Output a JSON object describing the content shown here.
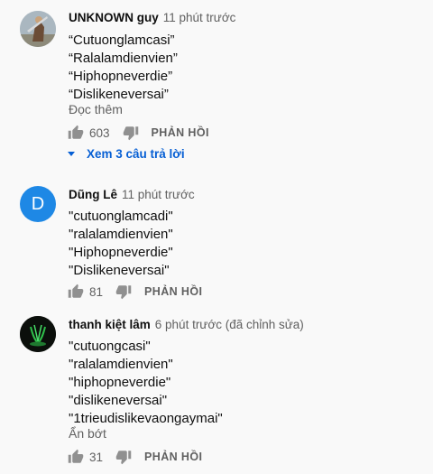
{
  "colors": {
    "link": "#065fd4",
    "muted": "#606060",
    "avatar_d": "#1e88e5"
  },
  "comments": [
    {
      "author": "UNKNOWN guy",
      "time": "11 phút trước",
      "lines": [
        "“Cutuonglamcasi”",
        "“Ralalamdienvien”",
        "“Hiphopneverdie”",
        "“Dislikeneversai”"
      ],
      "more": "Đọc thêm",
      "likes": "603",
      "reply": "PHẢN HỒI",
      "view_replies": "Xem 3 câu trả lời"
    },
    {
      "author": "Dũng Lê",
      "time": "11 phút trước",
      "avatar_letter": "D",
      "lines": [
        "\"cutuonglamcadi\"",
        "\"ralalamdienvien\"",
        "\"Hiphopneverdie\"",
        "\"Dislikeneversai\""
      ],
      "likes": "81",
      "reply": "PHẢN HỒI"
    },
    {
      "author": "thanh kiệt lâm",
      "time": "6 phút trước (đã chỉnh sửa)",
      "lines": [
        "\"cutuongcasi\"",
        "\"ralalamdienvien\"",
        "\"hiphopneverdie\"",
        "\"dislikeneversai\"",
        "\"1trieudislikevaongaymai\""
      ],
      "more": "Ẩn bớt",
      "likes": "31",
      "reply": "PHẢN HỒI"
    }
  ]
}
